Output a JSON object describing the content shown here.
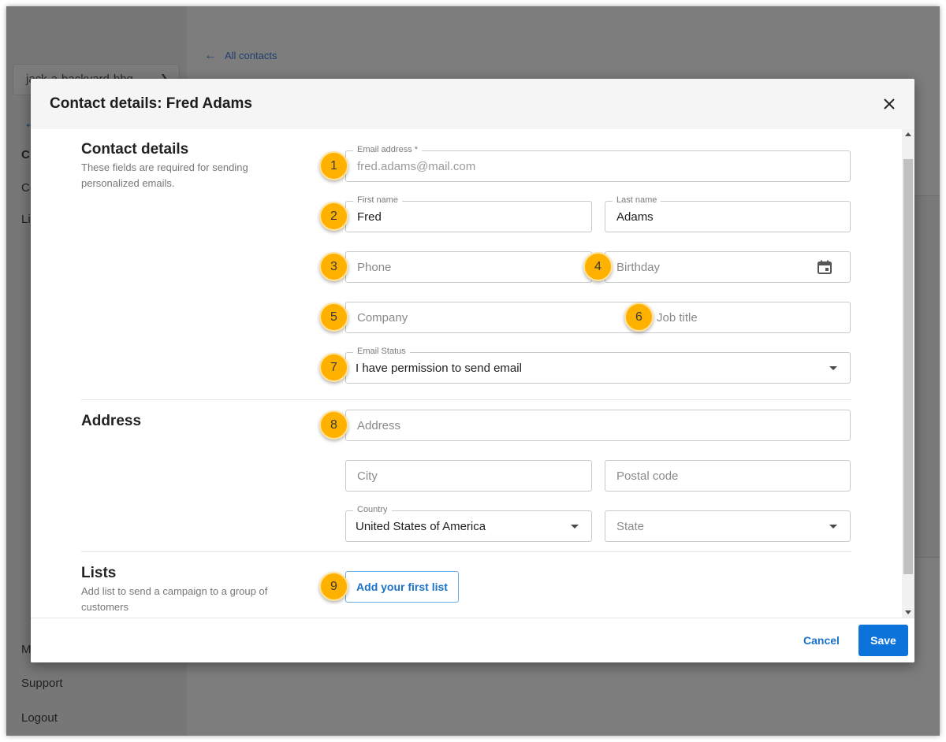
{
  "background": {
    "account_name": "jack-a-backyard-bbq",
    "sidebar_item_1": "C",
    "sidebar_item_2": "Co",
    "sidebar_item_3": "Li",
    "sidebar_item_4": "M",
    "support_label": "Support",
    "logout_label": "Logout",
    "all_contacts_label": "All contacts"
  },
  "modal": {
    "title": "Contact details: Fred Adams",
    "sections": {
      "contact": {
        "title": "Contact details",
        "description": "These fields are required for sending personalized emails."
      },
      "address": {
        "title": "Address"
      },
      "lists": {
        "title": "Lists",
        "description": "Add list to send a campaign to a group of customers"
      }
    },
    "fields": {
      "email": {
        "label": "Email address *",
        "value": "fred.adams@mail.com"
      },
      "first_name": {
        "label": "First name",
        "value": "Fred"
      },
      "last_name": {
        "label": "Last name",
        "value": "Adams"
      },
      "phone": {
        "placeholder": "Phone"
      },
      "birthday": {
        "placeholder": "Birthday"
      },
      "company": {
        "placeholder": "Company"
      },
      "job_title": {
        "placeholder": "Job title"
      },
      "email_status": {
        "label": "Email Status",
        "value": "I have permission to send email"
      },
      "address": {
        "placeholder": "Address"
      },
      "city": {
        "placeholder": "City"
      },
      "postal_code": {
        "placeholder": "Postal code"
      },
      "country": {
        "label": "Country",
        "value": "United States of America"
      },
      "state": {
        "placeholder": "State"
      }
    },
    "add_list_label": "Add your first list",
    "cancel_label": "Cancel",
    "save_label": "Save"
  },
  "badges": [
    "1",
    "2",
    "3",
    "4",
    "5",
    "6",
    "7",
    "8",
    "9"
  ],
  "colors": {
    "accent": "#0b73d9",
    "badge": "#ffb100",
    "overlay": "#7d7d7d"
  }
}
